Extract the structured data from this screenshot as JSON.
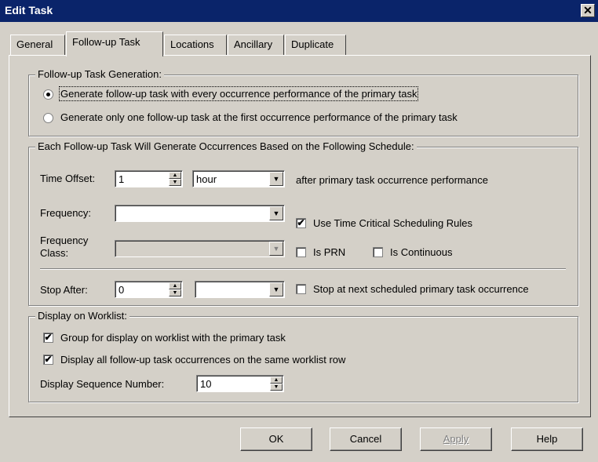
{
  "window": {
    "title": "Edit Task",
    "close_glyph": "✕"
  },
  "tabs": [
    {
      "label": "General"
    },
    {
      "label": "Follow-up Task"
    },
    {
      "label": "Locations"
    },
    {
      "label": "Ancillary"
    },
    {
      "label": "Duplicate"
    }
  ],
  "active_tab": "Follow-up Task",
  "generation": {
    "legend": "Follow-up Task Generation:",
    "options": [
      {
        "label": "Generate follow-up task with every occurrence performance of the primary task",
        "selected": true
      },
      {
        "label": "Generate only one follow-up task at the first occurrence performance of the primary task",
        "selected": false
      }
    ]
  },
  "schedule": {
    "legend": "Each Follow-up Task Will Generate Occurrences Based on the Following Schedule:",
    "time_offset": {
      "label": "Time Offset:",
      "value": "1",
      "unit": "hour",
      "suffix": "after primary task occurrence performance"
    },
    "frequency": {
      "label": "Frequency:",
      "value": ""
    },
    "use_time_critical": {
      "label": "Use Time Critical Scheduling Rules",
      "checked": true
    },
    "frequency_class": {
      "label_line1": "Frequency",
      "label_line2": "Class:",
      "value": ""
    },
    "is_prn": {
      "label": "Is PRN",
      "checked": false
    },
    "is_continuous": {
      "label": "Is Continuous",
      "checked": false
    },
    "stop_after": {
      "label": "Stop After:",
      "value": "0",
      "unit": ""
    },
    "stop_at_next": {
      "label": "Stop at next scheduled primary task occurrence",
      "checked": false
    }
  },
  "worklist": {
    "legend": "Display on Worklist:",
    "group_for_display": {
      "label": "Group for display on worklist with the primary task",
      "checked": true
    },
    "display_all": {
      "label": "Display all follow-up task occurrences on the same worklist row",
      "checked": true
    },
    "sequence": {
      "label": "Display Sequence Number:",
      "value": "10"
    }
  },
  "buttons": {
    "ok": "OK",
    "cancel": "Cancel",
    "apply": "Apply",
    "help": "Help"
  },
  "icons": {
    "spin_up": "▲",
    "spin_down": "▼",
    "dropdown": "▼",
    "check": "✔"
  }
}
